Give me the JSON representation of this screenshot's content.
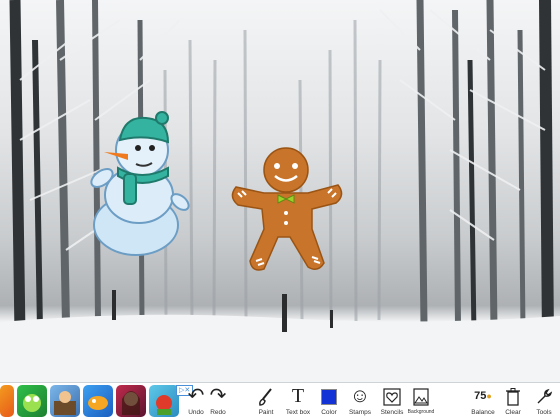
{
  "toolbar": {
    "undo": "Undo",
    "redo": "Redo",
    "paint": "Paint",
    "text_box": "Text box",
    "color": "Color",
    "stamps": "Stamps",
    "stencils": "Stencils",
    "background": "Background",
    "balance_value": "75",
    "balance_label": "Balance",
    "clear": "Clear",
    "tools": "Tools"
  },
  "ad_strip": {
    "apps": [
      "app-1",
      "app-2",
      "app-3",
      "app-4",
      "app-5",
      "app-6"
    ]
  },
  "colors": {
    "selected_color": "#1433d6",
    "gingerbread": "#c8742a",
    "snowman_hat": "#34b3a0"
  },
  "icons": {
    "undo": "undo-icon",
    "redo": "redo-icon",
    "paint": "paintbrush-icon",
    "text_box": "text-t-icon",
    "color": "color-swatch",
    "stamps": "smiley-icon",
    "stencils": "heart-icon",
    "background": "picture-icon",
    "balance": "coin-icon",
    "clear": "trash-icon",
    "tools": "wrench-icon"
  }
}
